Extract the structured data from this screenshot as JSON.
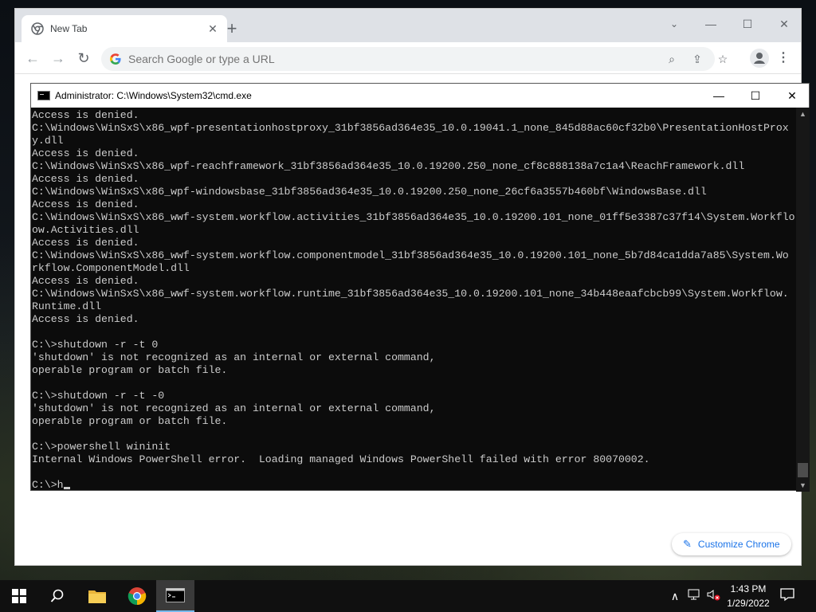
{
  "browser": {
    "tab_title": "New Tab",
    "omnibox_placeholder": "Search Google or type a URL",
    "customize_label": "Customize Chrome",
    "colors": {
      "titlebar": "#dee1e6",
      "accent": "#1a73e8"
    }
  },
  "console_window": {
    "title": "Administrator: C:\\Windows\\System32\\cmd.exe",
    "lines": [
      "Access is denied.",
      "C:\\Windows\\WinSxS\\x86_wpf-presentationhostproxy_31bf3856ad364e35_10.0.19041.1_none_845d88ac60cf32b0\\PresentationHostProx",
      "y.dll",
      "Access is denied.",
      "C:\\Windows\\WinSxS\\x86_wpf-reachframework_31bf3856ad364e35_10.0.19200.250_none_cf8c888138a7c1a4\\ReachFramework.dll",
      "Access is denied.",
      "C:\\Windows\\WinSxS\\x86_wpf-windowsbase_31bf3856ad364e35_10.0.19200.250_none_26cf6a3557b460bf\\WindowsBase.dll",
      "Access is denied.",
      "C:\\Windows\\WinSxS\\x86_wwf-system.workflow.activities_31bf3856ad364e35_10.0.19200.101_none_01ff5e3387c37f14\\System.Workflo",
      "ow.Activities.dll",
      "Access is denied.",
      "C:\\Windows\\WinSxS\\x86_wwf-system.workflow.componentmodel_31bf3856ad364e35_10.0.19200.101_none_5b7d84ca1dda7a85\\System.Wo",
      "rkflow.ComponentModel.dll",
      "Access is denied.",
      "C:\\Windows\\WinSxS\\x86_wwf-system.workflow.runtime_31bf3856ad364e35_10.0.19200.101_none_34b448eaafcbcb99\\System.Workflow.",
      "Runtime.dll",
      "Access is denied.",
      "",
      "C:\\>shutdown -r -t 0",
      "'shutdown' is not recognized as an internal or external command,",
      "operable program or batch file.",
      "",
      "C:\\>shutdown -r -t -0",
      "'shutdown' is not recognized as an internal or external command,",
      "operable program or batch file.",
      "",
      "C:\\>powershell wininit",
      "Internal Windows PowerShell error.  Loading managed Windows PowerShell failed with error 80070002.",
      ""
    ],
    "prompt": "C:\\>h",
    "colors": {
      "background": "#0c0c0c",
      "text": "#cccccc"
    }
  },
  "taskbar": {
    "time": "1:43 PM",
    "date": "1/29/2022",
    "pinned": [
      "start-icon",
      "search-icon",
      "file-explorer-icon",
      "chrome-icon",
      "cmd-icon"
    ]
  }
}
